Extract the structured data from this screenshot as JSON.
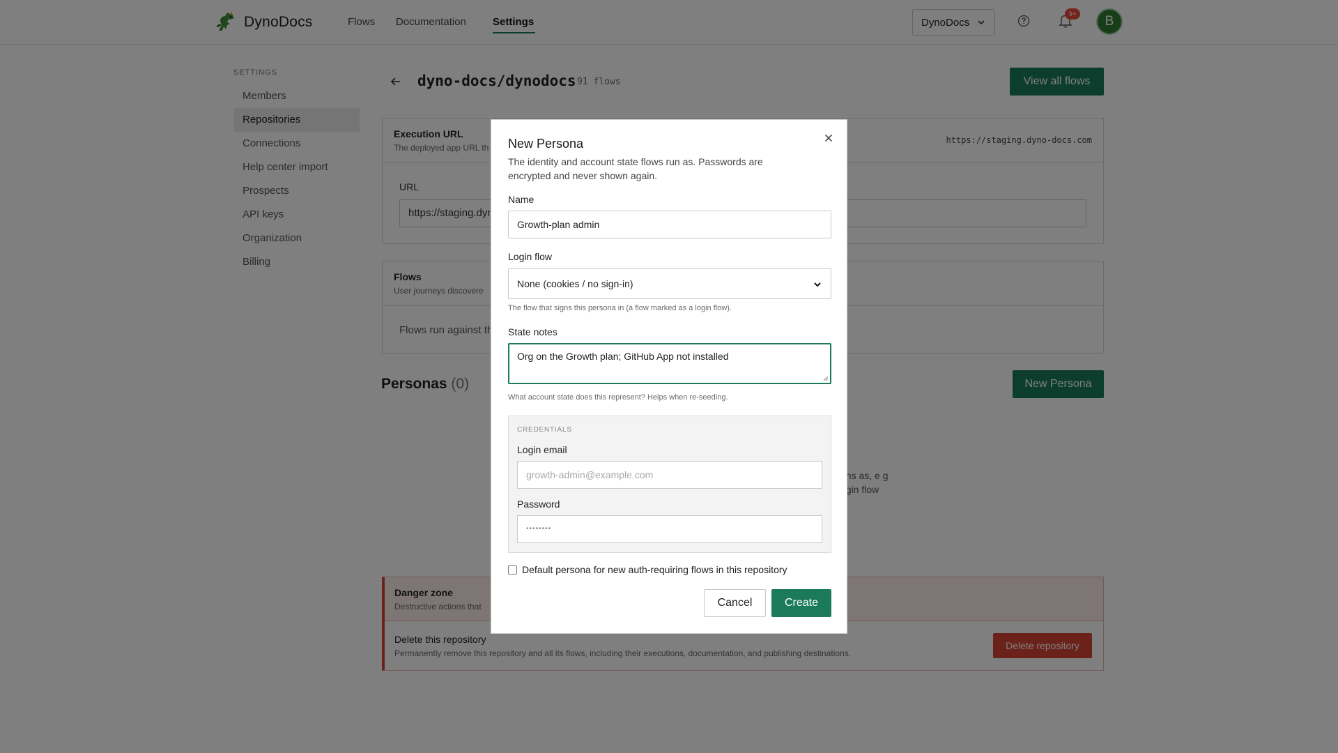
{
  "brand": {
    "name": "DynoDocs",
    "logo_icon": "dinosaur-icon"
  },
  "nav": {
    "links": [
      {
        "label": "Flows"
      },
      {
        "label": "Documentation"
      },
      {
        "label": "Settings"
      }
    ],
    "active": "Settings",
    "org_select": "DynoDocs",
    "notif_badge": "9+",
    "avatar_initial": "B"
  },
  "sidebar": {
    "heading": "SETTINGS",
    "items": [
      {
        "label": "Members"
      },
      {
        "label": "Repositories"
      },
      {
        "label": "Connections"
      },
      {
        "label": "Help center import"
      },
      {
        "label": "Prospects"
      },
      {
        "label": "API keys"
      },
      {
        "label": "Organization"
      },
      {
        "label": "Billing"
      }
    ],
    "active": "Repositories"
  },
  "repo": {
    "title": "dyno-docs/dynodocs",
    "flow_count": "91 flows",
    "view_all_label": "View all flows"
  },
  "execution": {
    "title": "Execution URL",
    "desc": "The deployed app URL th",
    "url_display": "https://staging.dyno-docs.com",
    "url_label": "URL",
    "url_value": "https://staging.dyn"
  },
  "flows": {
    "title": "Flows",
    "desc": "User journeys discovere",
    "body": "Flows run against th"
  },
  "personas": {
    "title": "Personas",
    "count": "(0)",
    "new_label": "New Persona",
    "empty_line1": "uns as, e g",
    "empty_line2": "ogin flow"
  },
  "danger": {
    "title": "Danger zone",
    "desc": "Destructive actions that",
    "delete_title": "Delete this repository",
    "delete_desc": "Permanently remove this repository and all its flows, including their executions, documentation, and publishing destinations.",
    "delete_button": "Delete repository"
  },
  "modal": {
    "title": "New Persona",
    "desc": "The identity and account state flows run as. Passwords are encrypted and never shown again.",
    "name_label": "Name",
    "name_value": "Growth-plan admin",
    "login_flow_label": "Login flow",
    "login_flow_value": "None (cookies / no sign-in)",
    "login_flow_hint": "The flow that signs this persona in (a flow marked as a login flow).",
    "state_notes_label": "State notes",
    "state_notes_value": "Org on the Growth plan; GitHub App not installed",
    "state_notes_hint": "What account state does this represent? Helps when re-seeding.",
    "credentials_heading": "CREDENTIALS",
    "login_email_label": "Login email",
    "login_email_placeholder": "growth-admin@example.com",
    "password_label": "Password",
    "password_placeholder": "••••••••",
    "default_checkbox_label": "Default persona for new auth-requiring flows in this repository",
    "cancel_label": "Cancel",
    "create_label": "Create"
  },
  "colors": {
    "accent": "#1a7a5a",
    "danger": "#d64534",
    "badge": "#e5483a",
    "avatar": "#2e7d32"
  }
}
